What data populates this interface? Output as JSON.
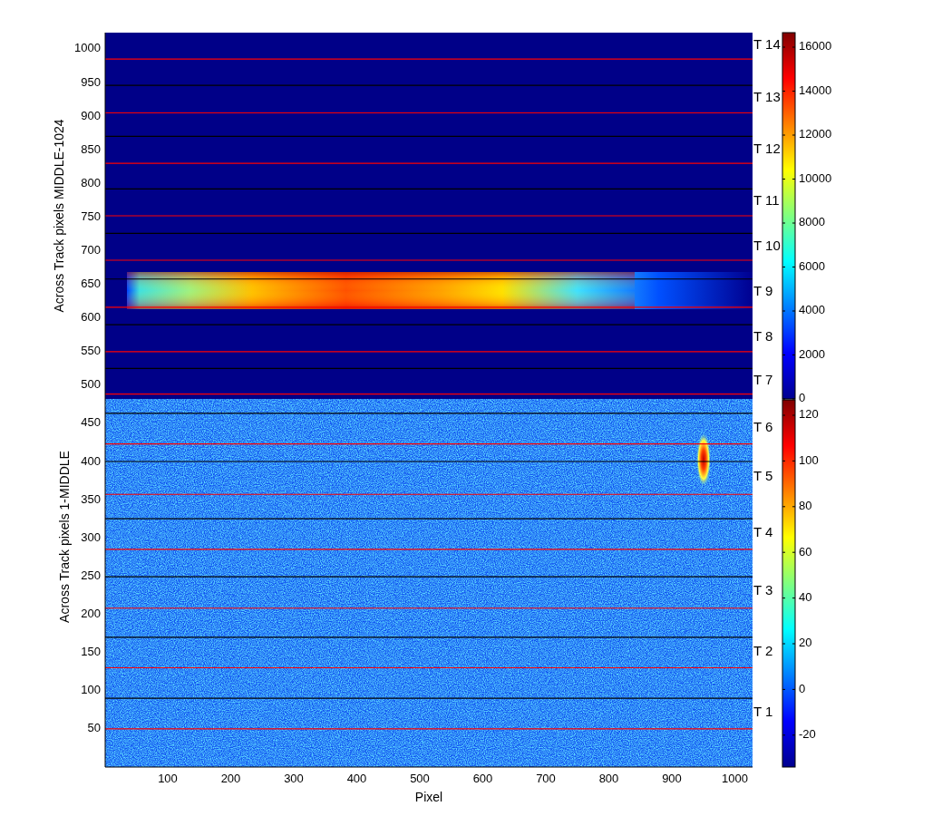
{
  "upper_panel": {
    "ylabel": "Across Track pixels MIDDLE-1024",
    "yticks": [
      "1000",
      "950",
      "900",
      "850",
      "800",
      "750",
      "700",
      "650",
      "600",
      "550",
      "500"
    ]
  },
  "lower_panel": {
    "ylabel": "Across Track pixels 1-MIDDLE",
    "yticks": [
      "450",
      "400",
      "350",
      "300",
      "250",
      "200",
      "150",
      "100",
      "50"
    ]
  },
  "x_axis": {
    "label": "Pixel",
    "ticks": [
      "100",
      "200",
      "300",
      "400",
      "500",
      "600",
      "700",
      "800",
      "900",
      "1000"
    ]
  },
  "track_labels": [
    "T 14",
    "T 13",
    "T 12",
    "T 11",
    "T 10",
    "T 9",
    "T 8",
    "T 7",
    "T 6",
    "T 5",
    "T 4",
    "T 3",
    "T 2",
    "T 1"
  ],
  "upper_colorbar": {
    "ticks": [
      "16000",
      "14000",
      "12000",
      "10000",
      "8000",
      "6000",
      "4000",
      "2000",
      "0"
    ]
  },
  "lower_colorbar": {
    "ticks": [
      "120",
      "100",
      "80",
      "60",
      "40",
      "20",
      "0",
      "-20"
    ]
  }
}
